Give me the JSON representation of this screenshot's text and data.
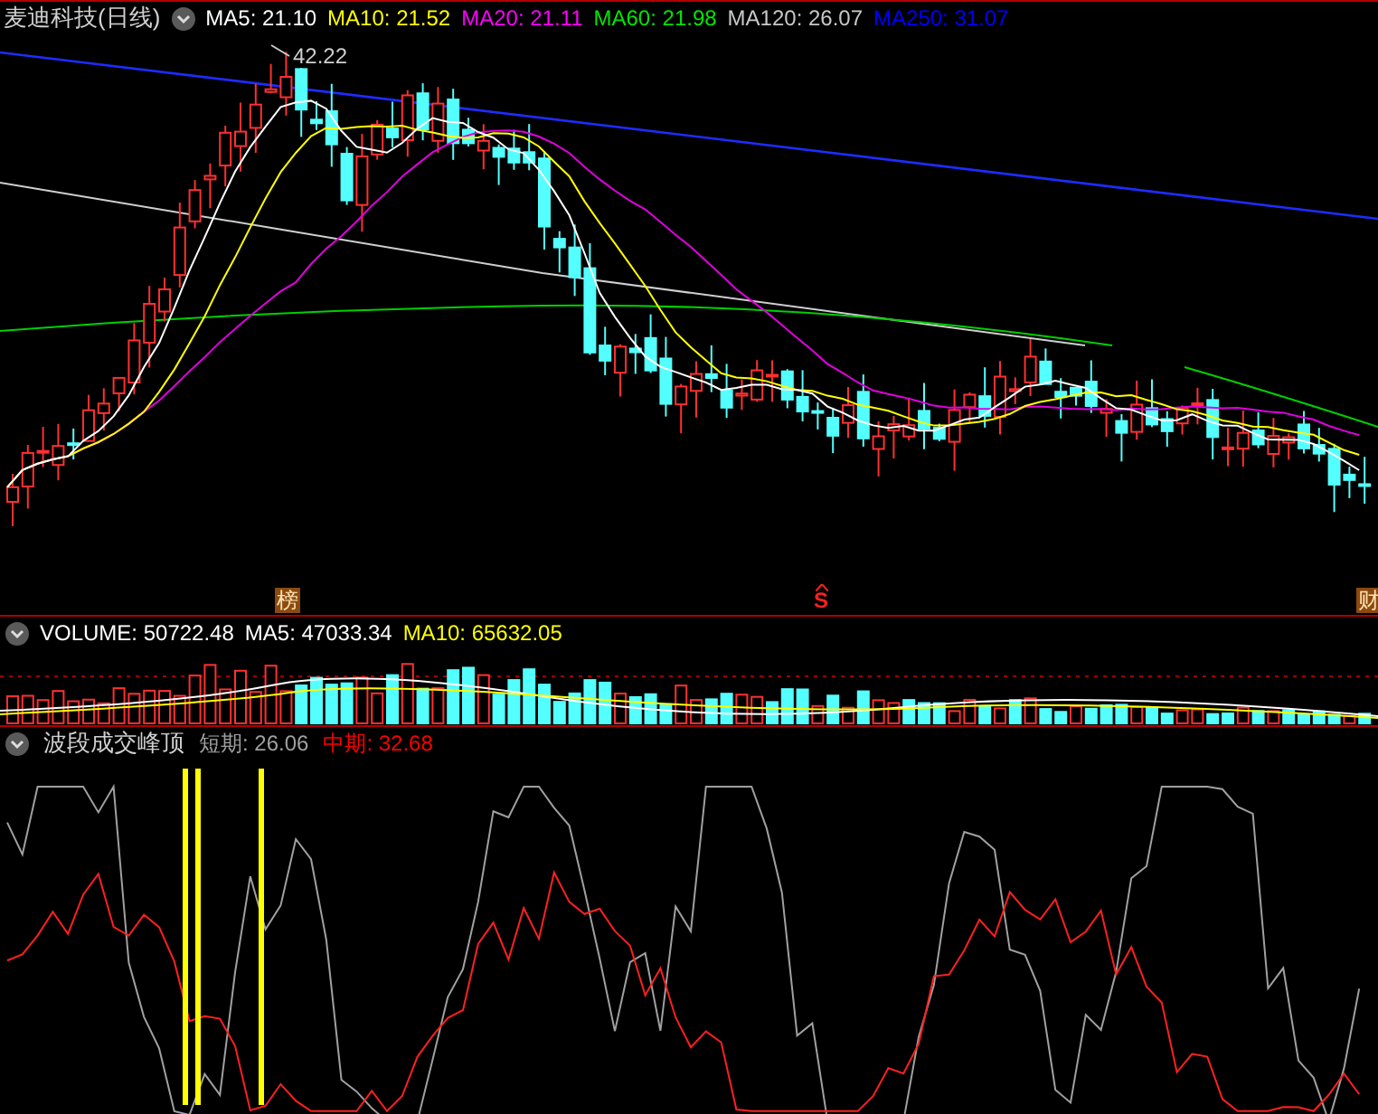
{
  "stock": {
    "name": "麦迪科技",
    "period": "(日线)",
    "indicators": [
      {
        "label": "MA5: 21.10",
        "color": "#ffffff"
      },
      {
        "label": "MA10: 21.52",
        "color": "#ffff00"
      },
      {
        "label": "MA20: 21.11",
        "color": "#ff00ff"
      },
      {
        "label": "MA60: 21.98",
        "color": "#00e600"
      },
      {
        "label": "MA120: 26.07",
        "color": "#c8c8c8"
      },
      {
        "label": "MA250: 31.07",
        "color": "#0000ff"
      }
    ]
  },
  "price_chart": {
    "high_label": "42.22",
    "markers": [
      {
        "text": "榜",
        "kind": "tag"
      },
      {
        "text": "S",
        "kind": "signal"
      },
      {
        "text": "财",
        "kind": "tag"
      }
    ]
  },
  "volume": {
    "title": "VOLUME: 50722.48",
    "indicators": [
      {
        "label": "MA5: 47033.34",
        "color": "#ffffff"
      },
      {
        "label": "MA10: 65632.05",
        "color": "#ffff00"
      }
    ]
  },
  "indicator": {
    "title": "波段成交峰顶",
    "values": [
      {
        "label": "短期: 26.06",
        "color": "#a0a0a0"
      },
      {
        "label": "中期: 32.68",
        "color": "#ff0000"
      }
    ]
  }
}
